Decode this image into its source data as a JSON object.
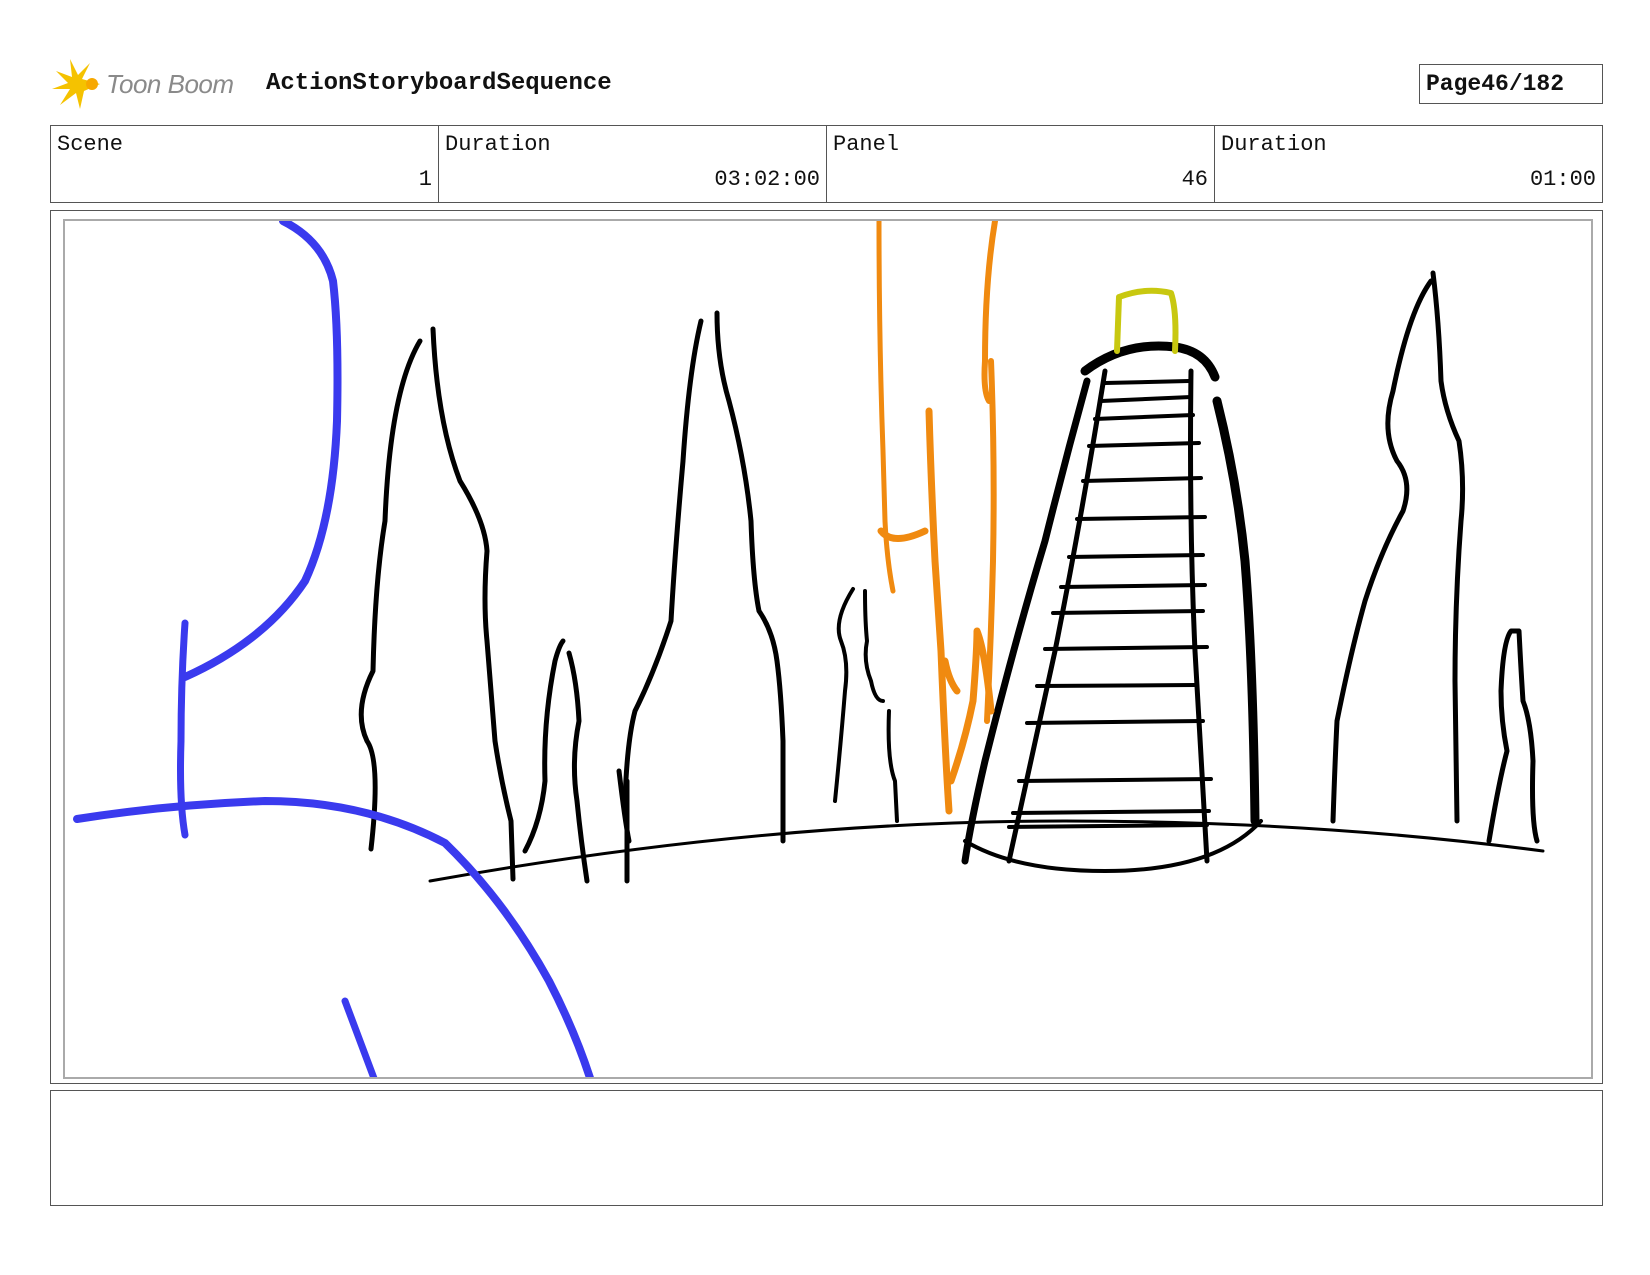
{
  "header": {
    "logo_text": "Toon Boom",
    "sequence_title": "ActionStoryboardSequence",
    "page_label": "Page",
    "page_value": "46/182"
  },
  "info": {
    "scene_label": "Scene",
    "scene_value": "1",
    "scene_duration_label": "Duration",
    "scene_duration_value": "03:02:00",
    "panel_label": "Panel",
    "panel_value": "46",
    "panel_duration_label": "Duration",
    "panel_duration_value": "01:00"
  },
  "colors": {
    "ink": "#000000",
    "blue": "#3a3aee",
    "orange": "#f08a10",
    "yellow": "#c8c810",
    "logo_star": "#f5c200"
  }
}
